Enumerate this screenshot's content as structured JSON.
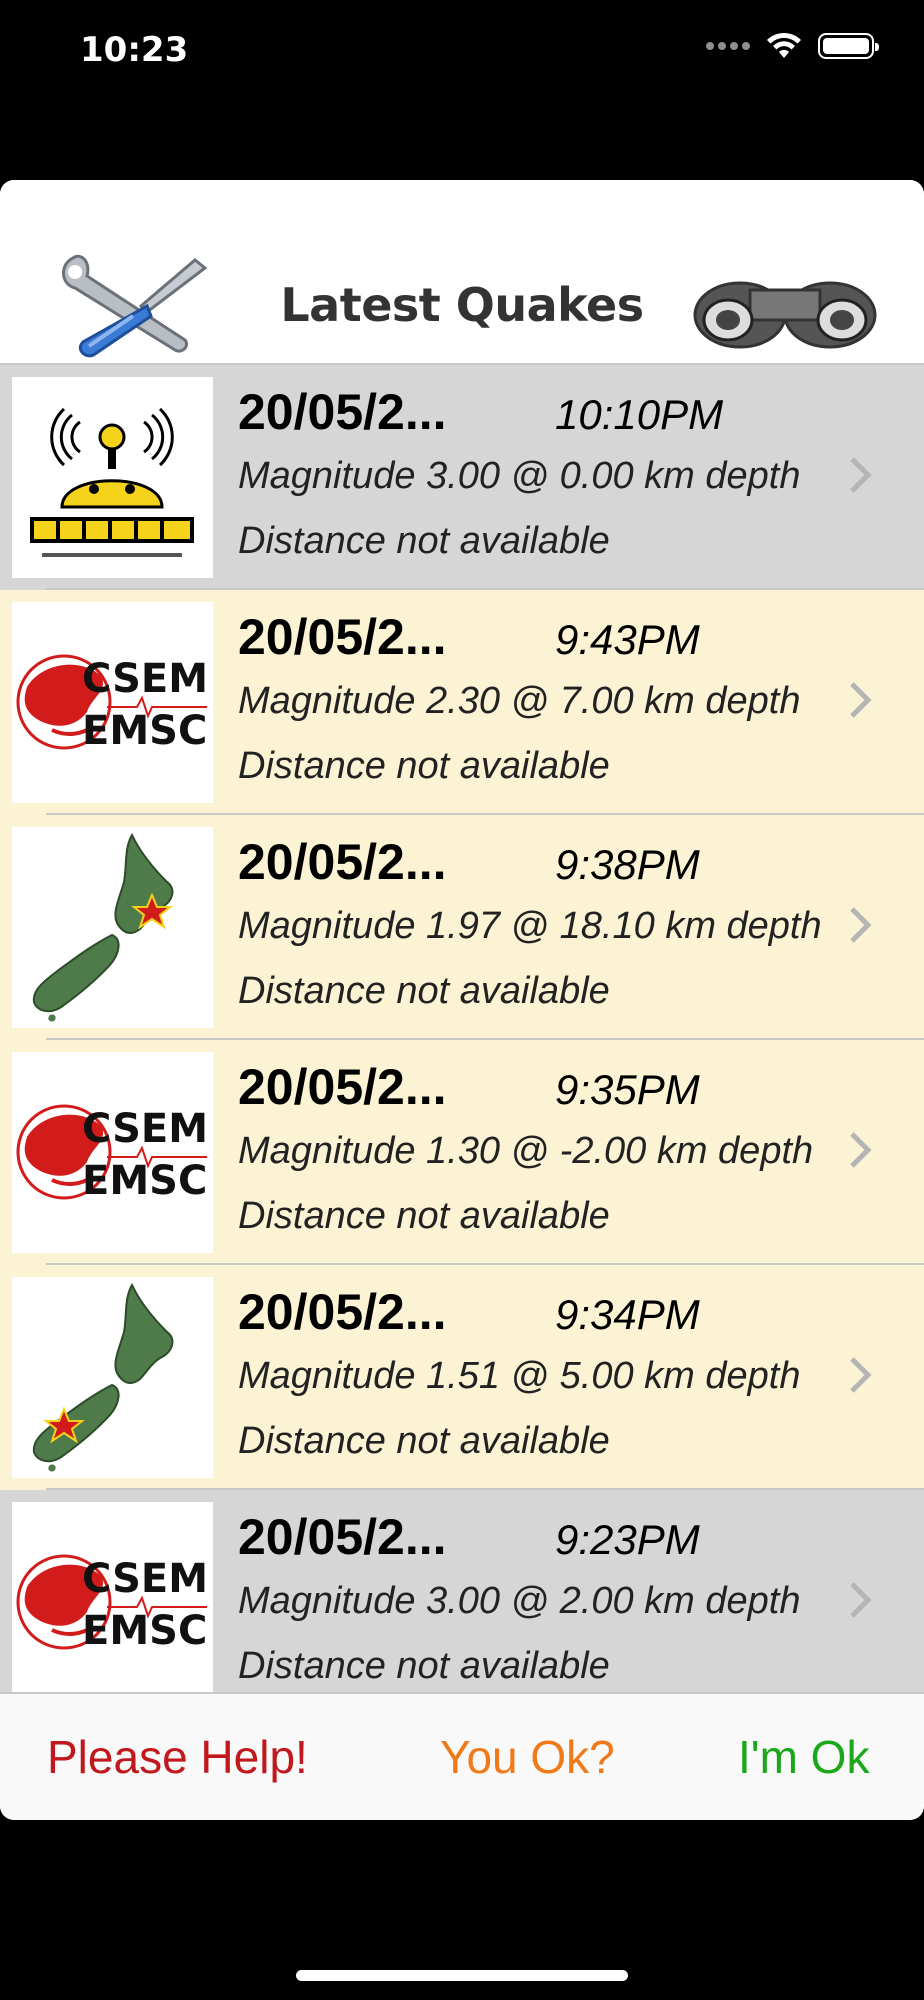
{
  "status_bar": {
    "time": "10:23",
    "battery_level": 1.0
  },
  "header": {
    "title": "Latest Quakes",
    "settings_icon": "wrench-screwdriver-icon",
    "search_icon": "binoculars-icon"
  },
  "quakes": [
    {
      "source_icon": "jma-robot-logo",
      "date": "20/05/2...",
      "time": "10:10PM",
      "magnitude_text": "Magnitude 3.00 @ 0.00 km depth",
      "distance_text": "Distance not available",
      "bg": "#d6d6d6"
    },
    {
      "source_icon": "csem-emsc-logo",
      "date": "20/05/2...",
      "time": "9:43PM",
      "magnitude_text": "Magnitude 2.30 @ 7.00 km depth",
      "distance_text": "Distance not available",
      "bg": "#fbf3d4"
    },
    {
      "source_icon": "nz-map-star-north",
      "date": "20/05/2...",
      "time": "9:38PM",
      "magnitude_text": "Magnitude 1.97 @ 18.10 km depth",
      "distance_text": "Distance not available",
      "bg": "#fbf3d4"
    },
    {
      "source_icon": "csem-emsc-logo",
      "date": "20/05/2...",
      "time": "9:35PM",
      "magnitude_text": "Magnitude 1.30 @ -2.00 km depth",
      "distance_text": "Distance not available",
      "bg": "#fbf3d4"
    },
    {
      "source_icon": "nz-map-star-south",
      "date": "20/05/2...",
      "time": "9:34PM",
      "magnitude_text": "Magnitude 1.51 @ 5.00 km depth",
      "distance_text": "Distance not available",
      "bg": "#fbf3d4"
    },
    {
      "source_icon": "csem-emsc-logo",
      "date": "20/05/2...",
      "time": "9:23PM",
      "magnitude_text": "Magnitude 3.00 @ 2.00 km depth",
      "distance_text": "Distance not available",
      "bg": "#d6d6d6"
    }
  ],
  "csem_logo": {
    "line1": "CSEM",
    "line2": "EMSC"
  },
  "footer": {
    "help_label": "Please Help!",
    "help_color": "#c0181c",
    "youok_label": "You Ok?",
    "youok_color": "#f07a1a",
    "imok_label": "I'm Ok",
    "imok_color": "#1aa81a"
  }
}
